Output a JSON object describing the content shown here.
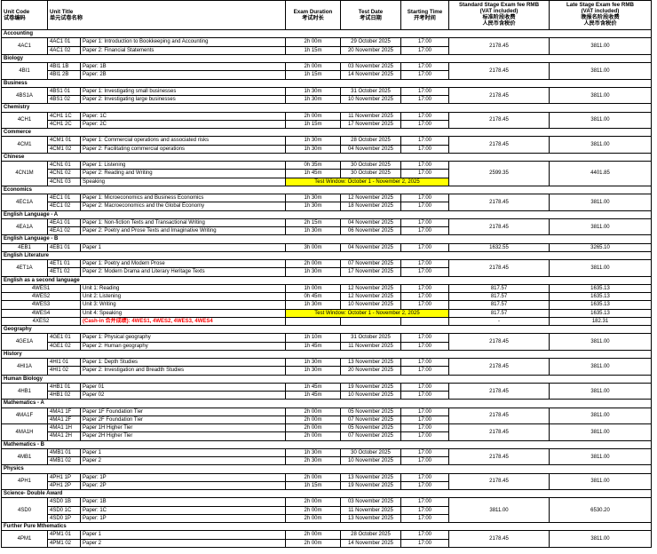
{
  "header": {
    "unit_code": [
      "Unit Code",
      "试卷编码"
    ],
    "unit_title": [
      "Unit Title",
      "单元试卷名称"
    ],
    "exam_duration": [
      "Exam Duration",
      "考试时长"
    ],
    "test_date": [
      "Test Date",
      "考试日期"
    ],
    "starting_time": [
      "Starting Time",
      "开考时间"
    ],
    "standard_fee": [
      "Standard Stage Exam fee RMB",
      "(VAT included)",
      "标准阶段收费",
      "人民币含税价"
    ],
    "late_fee": [
      "Late Stage Exam fee RMB",
      "(VAT included)",
      "晚报名阶段收费",
      "人民币含税价"
    ]
  },
  "colors": {
    "test_window_highlight": "#ffff00",
    "cash_in_text": "#ff0000",
    "grid_lines": "#000000"
  },
  "sections": [
    {
      "name": "Accounting",
      "groups": [
        {
          "code": "4AC1",
          "standard_fee": "2178.45",
          "late_fee": "3811.00",
          "papers": [
            {
              "code": "4AC1 01",
              "title": "Paper 1: Introduction to Bookkeeping and Accounting",
              "duration": "2h 00m",
              "date": "29 October 2025",
              "time": "17:00"
            },
            {
              "code": "4AC1 02",
              "title": "Paper 2: Financial Statements",
              "duration": "1h 15m",
              "date": "20 November 2025",
              "time": "17:00"
            }
          ]
        }
      ]
    },
    {
      "name": "Biology",
      "groups": [
        {
          "code": "4BI1",
          "standard_fee": "2178.45",
          "late_fee": "3811.00",
          "papers": [
            {
              "code": "4BI1 1B",
              "title": "Paper: 1B",
              "duration": "2h 00m",
              "date": "03 November 2025",
              "time": "17:00"
            },
            {
              "code": "4BI1 2B",
              "title": "Paper: 2B",
              "duration": "1h 15m",
              "date": "14 November 2025",
              "time": "17:00"
            }
          ]
        }
      ]
    },
    {
      "name": "Business",
      "groups": [
        {
          "code": "4BS1A",
          "standard_fee": "2178.45",
          "late_fee": "3811.00",
          "papers": [
            {
              "code": "4BS1 01",
              "title": "Paper 1: Investigating small businesses",
              "duration": "1h 30m",
              "date": "31 October 2025",
              "time": "17:00"
            },
            {
              "code": "4BS1 02",
              "title": "Paper 2: Investigating large businesses",
              "duration": "1h 30m",
              "date": "10 November 2025",
              "time": "17:00"
            }
          ]
        }
      ]
    },
    {
      "name": "Chemistry",
      "groups": [
        {
          "code": "4CH1",
          "standard_fee": "2178.45",
          "late_fee": "3811.00",
          "papers": [
            {
              "code": "4CH1 1C",
              "title": "Paper: 1C",
              "duration": "2h 00m",
              "date": "11 November 2025",
              "time": "17:00"
            },
            {
              "code": "4CH1 2C",
              "title": "Paper: 2C",
              "duration": "1h 15m",
              "date": "17 November 2025",
              "time": "17:00"
            }
          ]
        }
      ]
    },
    {
      "name": "Commerce",
      "groups": [
        {
          "code": "4CM1",
          "standard_fee": "2178.45",
          "late_fee": "3811.00",
          "papers": [
            {
              "code": "4CM1 01",
              "title": "Paper 1: Commercial operations and associated risks",
              "duration": "1h 30m",
              "date": "28 October 2025",
              "time": "17:00"
            },
            {
              "code": "4CM1 02",
              "title": "Paper 2: Facilitating commercial operations",
              "duration": "1h 30m",
              "date": "04 November 2025",
              "time": "17:00"
            }
          ]
        }
      ]
    },
    {
      "name": "Chinese",
      "groups": [
        {
          "code": "4CN1M",
          "standard_fee": "2599.35",
          "late_fee": "4401.85",
          "papers": [
            {
              "code": "4CN1 01",
              "title": "Paper 1: Listening",
              "duration": "0h 35m",
              "date": "30 October 2025",
              "time": "17:00"
            },
            {
              "code": "4CN1 02",
              "title": "Paper 2: Reading and Writing",
              "duration": "1h 45m",
              "date": "30 October 2025",
              "time": "17:00"
            },
            {
              "code": "4CN1 03",
              "title": "Speaking",
              "test_window": "Test Window: October 1 - November 2, 2025"
            }
          ]
        }
      ]
    },
    {
      "name": "Economics",
      "groups": [
        {
          "code": "4EC1A",
          "standard_fee": "2178.45",
          "late_fee": "3811.00",
          "papers": [
            {
              "code": "4EC1 01",
              "title": "Paper 1: Microeconomics and Business Economics",
              "duration": "1h 30m",
              "date": "12 November 2025",
              "time": "17:00"
            },
            {
              "code": "4EC1 02",
              "title": "Paper 2: Macroeconomics and the Global Economy",
              "duration": "1h 30m",
              "date": "18 November 2025",
              "time": "17:00"
            }
          ]
        }
      ]
    },
    {
      "name": "English Language - A",
      "groups": [
        {
          "code": "4EA1A",
          "standard_fee": "2178.45",
          "late_fee": "3811.00",
          "papers": [
            {
              "code": "4EA1 01",
              "title": "Paper 1: Non-fiction Texts and Transactional Writing",
              "duration": "2h 15m",
              "date": "04 November 2025",
              "time": "17:00"
            },
            {
              "code": "4EA1 02",
              "title": "Paper 2: Poetry and Prose Texts and Imaginative Writing",
              "duration": "1h 30m",
              "date": "06 November 2025",
              "time": "17:00"
            }
          ]
        }
      ]
    },
    {
      "name": "English Language - B",
      "groups": [
        {
          "code": "4EB1",
          "standard_fee": "1632.55",
          "late_fee": "3265.10",
          "papers": [
            {
              "code": "4EB1 01",
              "title": "Paper 1",
              "duration": "3h 00m",
              "date": "04 November 2025",
              "time": "17:00"
            }
          ]
        }
      ]
    },
    {
      "name": "English Literature",
      "groups": [
        {
          "code": "4ET1A",
          "standard_fee": "2178.45",
          "late_fee": "3811.00",
          "papers": [
            {
              "code": "4ET1 01",
              "title": "Paper 1: Poetry and Modern Prose",
              "duration": "2h 00m",
              "date": "07 November 2025",
              "time": "17:00"
            },
            {
              "code": "4ET1 02",
              "title": "Paper 2: Modern Drama and Literary Heritage Texts",
              "duration": "1h 30m",
              "date": "17 November 2025",
              "time": "17:00"
            }
          ]
        }
      ]
    },
    {
      "name": "English as a second language",
      "groups": [
        {
          "code": "4WES1",
          "standard_fee": "817.57",
          "late_fee": "1635.13",
          "papers": [
            {
              "title": "Unit 1: Reading",
              "duration": "1h 00m",
              "date": "12 November 2025",
              "time": "17:00"
            }
          ]
        },
        {
          "code": "4WES2",
          "standard_fee": "817.57",
          "late_fee": "1635.13",
          "papers": [
            {
              "title": "Unit 2: Listening",
              "duration": "0h 45m",
              "date": "12 November 2025",
              "time": "17:00"
            }
          ]
        },
        {
          "code": "4WES3",
          "standard_fee": "817.57",
          "late_fee": "1635.13",
          "papers": [
            {
              "title": "Unit 3: Writing",
              "duration": "1h 30m",
              "date": "10 November 2025",
              "time": "17:00"
            }
          ]
        },
        {
          "code": "4WES4",
          "standard_fee": "817.57",
          "late_fee": "1635.13",
          "papers": [
            {
              "title": "Unit 4: Speaking",
              "test_window": "Test Window: October 1 - November 2, 2025"
            }
          ]
        },
        {
          "code": "4XES2",
          "standard_fee": "-",
          "late_fee": "182.31",
          "papers": [
            {
              "cash_in": "(Cash-in 合并成绩): 4WES1, 4WES2, 4WES3, 4WES4"
            }
          ]
        }
      ]
    },
    {
      "name": "Geography",
      "groups": [
        {
          "code": "4GE1A",
          "standard_fee": "2178.45",
          "late_fee": "3811.00",
          "papers": [
            {
              "code": "4GE1 01",
              "title": "Paper 1: Physical geography",
              "duration": "1h 10m",
              "date": "31 October 2025",
              "time": "17:00"
            },
            {
              "code": "4GE1 02",
              "title": "Paper 2: Human geography",
              "duration": "1h 45m",
              "date": "11 November 2025",
              "time": "17:00"
            }
          ]
        }
      ]
    },
    {
      "name": "History",
      "groups": [
        {
          "code": "4HI1A",
          "standard_fee": "2178.45",
          "late_fee": "3811.00",
          "papers": [
            {
              "code": "4HI1 01",
              "title": "Paper 1: Depth Studies",
              "duration": "1h 30m",
              "date": "13 November 2025",
              "time": "17:00"
            },
            {
              "code": "4HI1 02",
              "title": "Paper 2: Investigation and Breadth Studies",
              "duration": "1h 30m",
              "date": "20 November 2025",
              "time": "17:00"
            }
          ]
        }
      ]
    },
    {
      "name": "Human Biology",
      "groups": [
        {
          "code": "4HB1",
          "standard_fee": "2178.45",
          "late_fee": "3811.00",
          "papers": [
            {
              "code": "4HB1 01",
              "title": "Paper 01",
              "duration": "1h 45m",
              "date": "19 November 2025",
              "time": "17:00"
            },
            {
              "code": "4HB1 02",
              "title": "Paper 02",
              "duration": "1h 45m",
              "date": "10 November 2025",
              "time": "17:00"
            }
          ]
        }
      ]
    },
    {
      "name": "Mathematics - A",
      "groups": [
        {
          "code": "4MA1F",
          "standard_fee": "2178.45",
          "late_fee": "3811.00",
          "papers": [
            {
              "code": "4MA1 1F",
              "title": "Paper 1F Foundation Tier",
              "duration": "2h 00m",
              "date": "05 November 2025",
              "time": "17:00"
            },
            {
              "code": "4MA1 2F",
              "title": "Paper 2F Foundation Tier",
              "duration": "2h 00m",
              "date": "07 November 2025",
              "time": "17:00"
            }
          ]
        },
        {
          "code": "4MA1H",
          "standard_fee": "2178.45",
          "late_fee": "3811.00",
          "papers": [
            {
              "code": "4MA1 1H",
              "title": "Paper 1H Higher Tier",
              "duration": "2h 00m",
              "date": "05 November 2025",
              "time": "17:00"
            },
            {
              "code": "4MA1 2H",
              "title": "Paper 2H Higher Tier",
              "duration": "2h 00m",
              "date": "07 November 2025",
              "time": "17:00"
            }
          ]
        }
      ]
    },
    {
      "name": "Mathematics - B",
      "groups": [
        {
          "code": "4MB1",
          "standard_fee": "2178.45",
          "late_fee": "3811.00",
          "papers": [
            {
              "code": "4MB1 01",
              "title": "Paper 1",
              "duration": "1h 30m",
              "date": "30 October 2025",
              "time": "17:00"
            },
            {
              "code": "4MB1 02",
              "title": "Paper 2",
              "duration": "2h 30m",
              "date": "10 November 2025",
              "time": "17:00"
            }
          ]
        }
      ]
    },
    {
      "name": "Physics",
      "groups": [
        {
          "code": "4PH1",
          "standard_fee": "2178.45",
          "late_fee": "3811.00",
          "papers": [
            {
              "code": "4PH1 1P",
              "title": "Paper: 1P",
              "duration": "2h 00m",
              "date": "13 November 2025",
              "time": "17:00"
            },
            {
              "code": "4PH1 2P",
              "title": "Paper: 2P",
              "duration": "1h 15m",
              "date": "19 November 2025",
              "time": "17:00"
            }
          ]
        }
      ]
    },
    {
      "name": "Science- Double Award",
      "groups": [
        {
          "code": "4SD0",
          "standard_fee": "3811.00",
          "late_fee": "6530.20",
          "papers": [
            {
              "code": "4SD0 1B",
              "title": "Paper: 1B",
              "duration": "2h 00m",
              "date": "03 November 2025",
              "time": "17:00"
            },
            {
              "code": "4SD0 1C",
              "title": "Paper: 1C",
              "duration": "2h 00m",
              "date": "11 November 2025",
              "time": "17:00"
            },
            {
              "code": "4SD0 1P",
              "title": "Paper: 1P",
              "duration": "2h 00m",
              "date": "13 November 2025",
              "time": "17:00"
            }
          ]
        }
      ]
    },
    {
      "name": "Further Pure Mthematics",
      "groups": [
        {
          "code": "4PM1",
          "standard_fee": "2178.45",
          "late_fee": "3811.00",
          "papers": [
            {
              "code": "4PM1 01",
              "title": "Paper 1",
              "duration": "2h 00m",
              "date": "28 October 2025",
              "time": "17:00"
            },
            {
              "code": "4PM1 02",
              "title": "Paper 2",
              "duration": "2h 00m",
              "date": "14 November 2025",
              "time": "17:00"
            }
          ]
        }
      ]
    }
  ]
}
